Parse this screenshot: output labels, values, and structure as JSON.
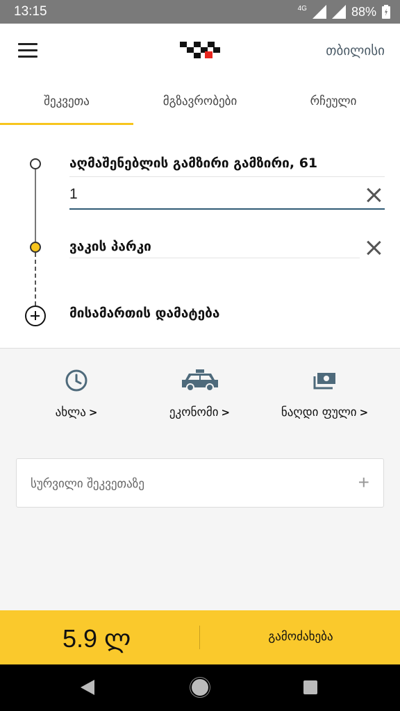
{
  "status_bar": {
    "time": "13:15",
    "network": "4G",
    "battery": "88%"
  },
  "header": {
    "city": "თბილისი"
  },
  "tabs": [
    {
      "label": "შეკვეთა",
      "active": true
    },
    {
      "label": "მგზავრობები",
      "active": false
    },
    {
      "label": "რჩეული",
      "active": false
    }
  ],
  "route": {
    "from_address": "აღმაშენებლის გამზირი გამზირი, 61",
    "entrance_value": "1",
    "to_address": "ვაკის პარკი",
    "add_address_label": "მისამართის დამატება"
  },
  "options": {
    "time_label": "ახლა",
    "tariff_label": "ეკონომი",
    "payment_label": "ნაღდი ფული"
  },
  "wishes": {
    "placeholder": "სურვილი შეკვეთაზე"
  },
  "footer": {
    "price": "5.9 ლ",
    "call_label": "გამოძახება"
  },
  "colors": {
    "accent_yellow": "#fac92c",
    "tab_indicator": "#f7c51d",
    "input_underline": "#2f5a74",
    "icon_slate": "#4e6a7b"
  },
  "icons": [
    "menu-icon",
    "taxi-logo-icon",
    "clock-icon",
    "car-icon",
    "cash-icon",
    "close-icon",
    "add-circle-icon",
    "plus-icon"
  ]
}
